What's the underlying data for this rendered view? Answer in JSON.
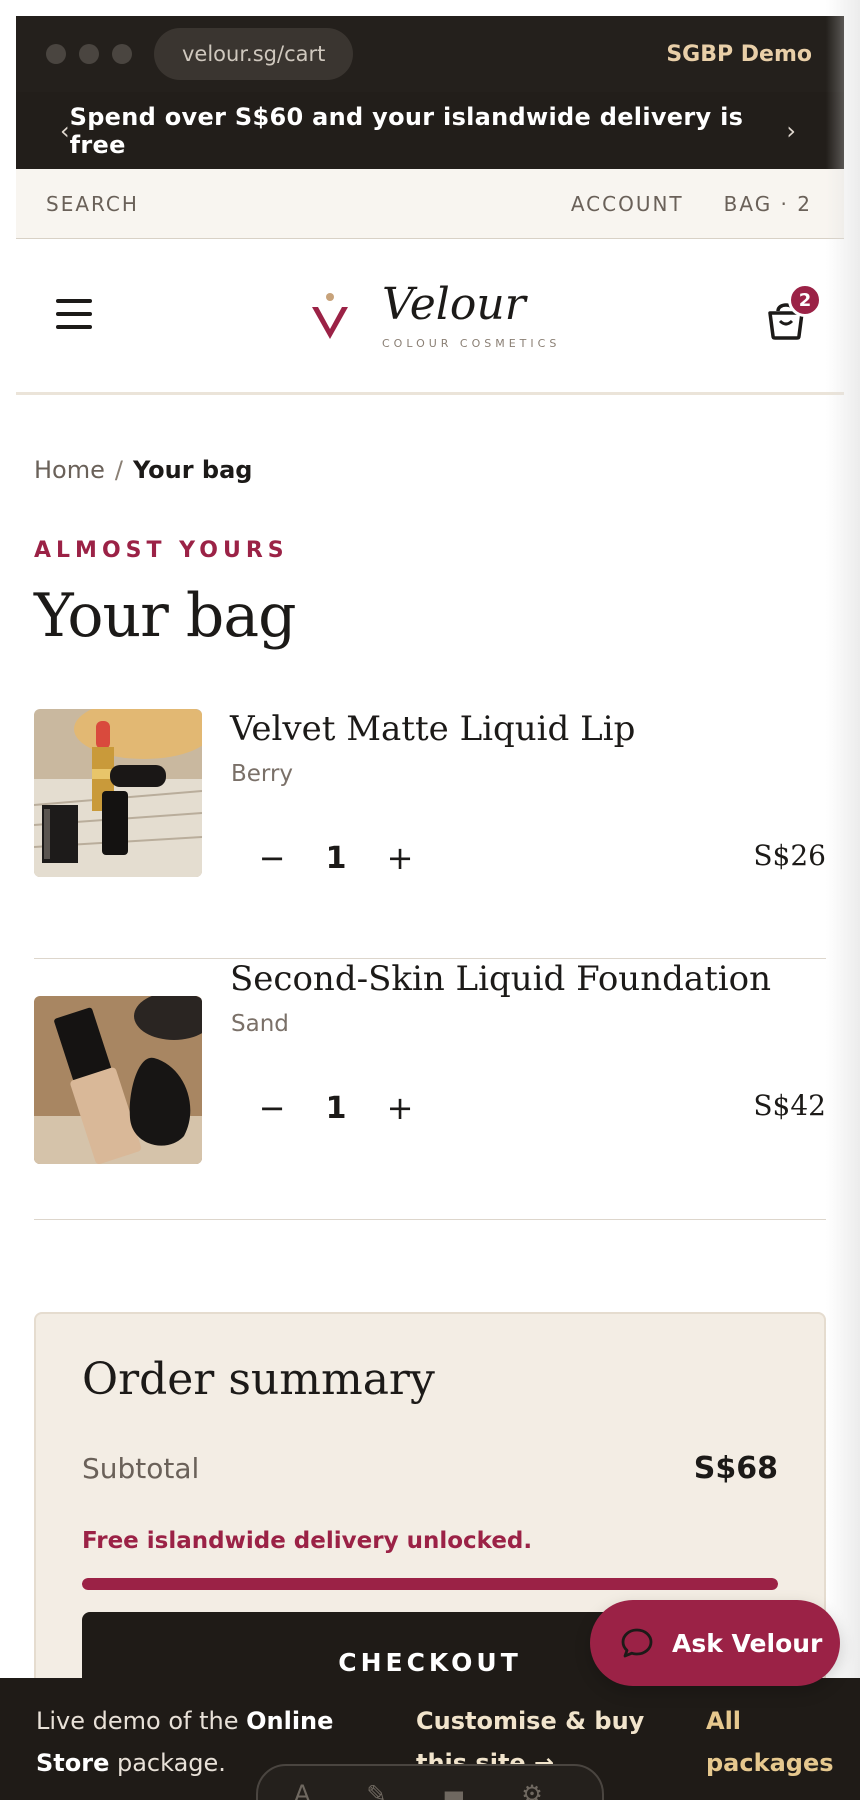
{
  "browser": {
    "url": "velour.sg/cart",
    "demo_label": "SGBP Demo"
  },
  "promo": {
    "prev_arrow": "‹",
    "next_arrow": "›",
    "text": "Spend over S$60 and your islandwide delivery is free"
  },
  "utility": {
    "search": "SEARCH",
    "account": "ACCOUNT",
    "bag": "BAG · 2"
  },
  "header": {
    "brand_name": "Velour",
    "brand_tagline": "COLOUR COSMETICS",
    "cart_count": "2",
    "brand_color": "#9b2246"
  },
  "breadcrumb": {
    "home": "Home",
    "separator": "/",
    "current": "Your bag"
  },
  "page": {
    "eyebrow": "ALMOST YOURS",
    "title": "Your bag"
  },
  "cart": {
    "items": [
      {
        "name": "Velvet Matte Liquid Lip",
        "variant": "Berry",
        "quantity": "1",
        "price": "S$26",
        "minus": "−",
        "plus": "+"
      },
      {
        "name": "Second-Skin Liquid Foundation",
        "variant": "Sand",
        "quantity": "1",
        "price": "S$42",
        "minus": "−",
        "plus": "+"
      }
    ]
  },
  "summary": {
    "title": "Order summary",
    "subtotal_label": "Subtotal",
    "subtotal_value": "S$68",
    "delivery_message": "Free islandwide delivery unlocked.",
    "delivery_progress": 1.0,
    "checkout_label": "CHECKOUT"
  },
  "chat": {
    "label": "Ask Velour"
  },
  "demo_bar": {
    "text_prefix": "Live demo of the ",
    "text_bold": "Online Store",
    "text_suffix": " package.",
    "customise_link": "Customise & buy this site →",
    "all_packages_link": "All packages"
  }
}
